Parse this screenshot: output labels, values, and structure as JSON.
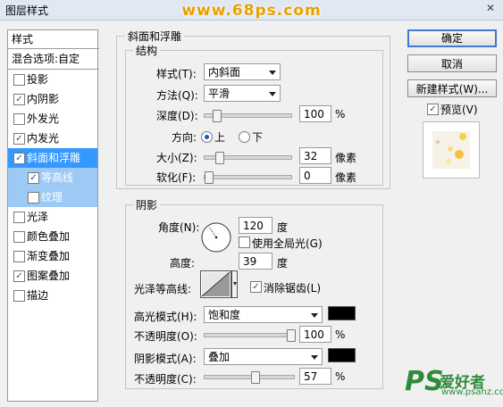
{
  "window": {
    "title": "图层样式",
    "watermark": "www.68ps.com",
    "close_symbol": "✕"
  },
  "style_list": {
    "header": "样式",
    "blend_options": "混合选项:自定",
    "items": [
      {
        "label": "投影",
        "checked": false
      },
      {
        "label": "内阴影",
        "checked": true
      },
      {
        "label": "外发光",
        "checked": false
      },
      {
        "label": "内发光",
        "checked": true
      },
      {
        "label": "斜面和浮雕",
        "checked": true,
        "active": true
      },
      {
        "label": "等高线",
        "checked": true,
        "sub": true
      },
      {
        "label": "纹理",
        "checked": false,
        "sub": true
      },
      {
        "label": "光泽",
        "checked": false
      },
      {
        "label": "颜色叠加",
        "checked": false
      },
      {
        "label": "渐变叠加",
        "checked": false
      },
      {
        "label": "图案叠加",
        "checked": true
      },
      {
        "label": "描边",
        "checked": false
      }
    ]
  },
  "bevel": {
    "section_title": "斜面和浮雕",
    "structure_title": "结构",
    "style_label": "样式(T):",
    "style_value": "内斜面",
    "method_label": "方法(Q):",
    "method_value": "平滑",
    "depth_label": "深度(D):",
    "depth_value": "100",
    "depth_unit": "%",
    "depth_level": 0.1,
    "direction_label": "方向:",
    "dir_up": "上",
    "dir_down": "下",
    "direction_selected": "上",
    "size_label": "大小(Z):",
    "size_value": "32",
    "size_unit": "像素",
    "size_level": 0.13,
    "soften_label": "软化(F):",
    "soften_value": "0",
    "soften_unit": "像素",
    "soften_level": 0
  },
  "shading": {
    "title": "阴影",
    "angle_label": "角度(N):",
    "angle_value": "120",
    "angle_unit": "度",
    "global_light_label": "使用全局光(G)",
    "global_light_checked": false,
    "altitude_label": "高度:",
    "altitude_value": "39",
    "altitude_unit": "度",
    "gloss_label": "光泽等高线:",
    "antialias_label": "消除锯齿(L)",
    "antialias_checked": true,
    "highlight_mode_label": "高光模式(H):",
    "highlight_mode_value": "饱和度",
    "highlight_color": "#000000",
    "highlight_opacity_label": "不透明度(O):",
    "highlight_opacity_value": "100",
    "highlight_opacity_unit": "%",
    "highlight_opacity_level": 1.0,
    "shadow_mode_label": "阴影模式(A):",
    "shadow_mode_value": "叠加",
    "shadow_color": "#000000",
    "shadow_opacity_label": "不透明度(C):",
    "shadow_opacity_value": "57",
    "shadow_opacity_unit": "%",
    "shadow_opacity_level": 0.57
  },
  "buttons": {
    "ok": "确定",
    "cancel": "取消",
    "new_style": "新建样式(W)...",
    "preview_label": "预览(V)",
    "preview_checked": true
  },
  "branding": {
    "logo": "PS",
    "logo_cn": "爱好者",
    "logo_url": "www.psahz.com"
  }
}
